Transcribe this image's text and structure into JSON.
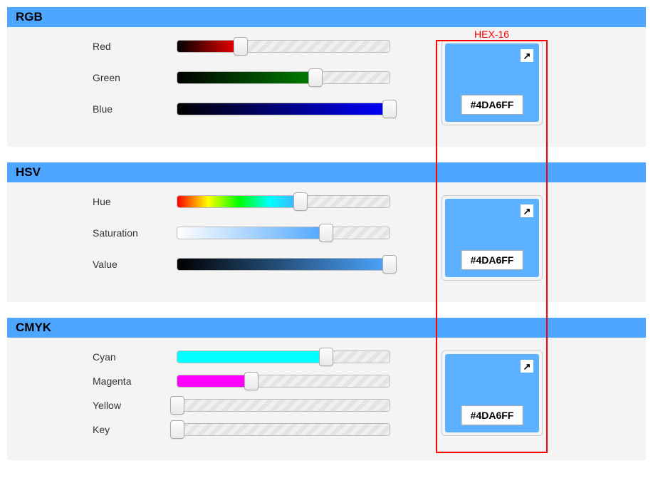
{
  "color_hex": "#4DA6FF",
  "swatch_bg": "#5bb0ff",
  "highlight_label": "HEX-16",
  "rgb": {
    "title": "RGB",
    "channels": [
      {
        "label": "Red",
        "percent": 30,
        "active_bg": "linear-gradient(to right,#000,#f00)"
      },
      {
        "label": "Green",
        "percent": 65,
        "active_bg": "linear-gradient(to right,#000,#008000)"
      },
      {
        "label": "Blue",
        "percent": 100,
        "active_bg": "linear-gradient(to right,#000,#0000ff)"
      }
    ]
  },
  "hsv": {
    "title": "HSV",
    "channels": [
      {
        "label": "Hue",
        "percent": 58,
        "active_bg": "linear-gradient(to right,#f00,#ff0,#0f0,#0ff,#4da6ff)"
      },
      {
        "label": "Saturation",
        "percent": 70,
        "active_bg": "linear-gradient(to right,#fff,#4da6ff)"
      },
      {
        "label": "Value",
        "percent": 100,
        "active_bg": "linear-gradient(to right,#000,#4da6ff)"
      }
    ]
  },
  "cmyk": {
    "title": "CMYK",
    "channels": [
      {
        "label": "Cyan",
        "percent": 70,
        "active_bg": "#00ffff"
      },
      {
        "label": "Magenta",
        "percent": 35,
        "active_bg": "#ff00ff"
      },
      {
        "label": "Yellow",
        "percent": 0,
        "active_bg": "#ffff00"
      },
      {
        "label": "Key",
        "percent": 0,
        "active_bg": "#000000"
      }
    ]
  }
}
